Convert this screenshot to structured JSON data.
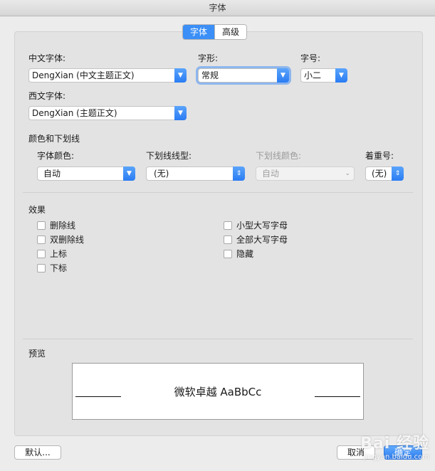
{
  "window": {
    "title": "字体"
  },
  "tabs": {
    "font": "字体",
    "advanced": "高级"
  },
  "font": {
    "chinese_label": "中文字体:",
    "chinese_value": "DengXian (中文主题正文)",
    "style_label": "字形:",
    "style_value": "常规",
    "size_label": "字号:",
    "size_value": "小二",
    "western_label": "西文字体:",
    "western_value": "DengXian (主题正文)"
  },
  "color_section": {
    "title": "颜色和下划线",
    "font_color_label": "字体颜色:",
    "font_color_value": "自动",
    "underline_style_label": "下划线线型:",
    "underline_style_value": "(无)",
    "underline_color_label": "下划线颜色:",
    "underline_color_value": "自动",
    "emphasis_label": "着重号:",
    "emphasis_value": "(无)"
  },
  "effects": {
    "title": "效果",
    "items": [
      "删除线",
      "双删除线",
      "上标",
      "下标",
      "小型大写字母",
      "全部大写字母",
      "隐藏"
    ]
  },
  "preview": {
    "title": "预览",
    "text": "微软卓越  AaBbCc"
  },
  "buttons": {
    "default": "默认...",
    "cancel": "取消",
    "ok": "确定"
  },
  "watermark": {
    "text": "Bai 经验",
    "sub": "jingyan.baidu.com"
  }
}
